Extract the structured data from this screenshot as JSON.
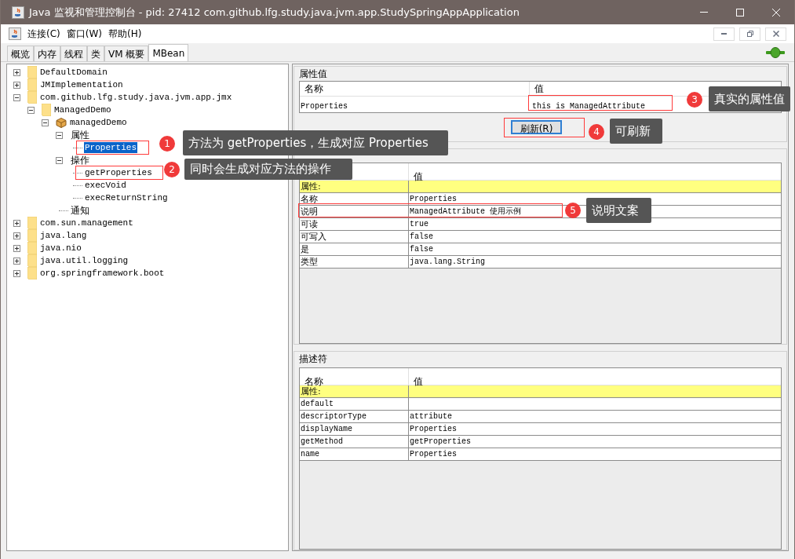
{
  "window": {
    "title": "Java 监视和管理控制台 - pid: 27412 com.github.lfg.study.java.jvm.app.StudySpringAppApplication"
  },
  "menu": [
    "连接(C)",
    "窗口(W)",
    "帮助(H)"
  ],
  "tabs": [
    {
      "label": "概览",
      "selected": false
    },
    {
      "label": "内存",
      "selected": false
    },
    {
      "label": "线程",
      "selected": false
    },
    {
      "label": "类",
      "selected": false
    },
    {
      "label": "VM 概要",
      "selected": false
    },
    {
      "label": "MBean",
      "selected": true
    }
  ],
  "tree": [
    {
      "label": "DefaultDomain",
      "kind": "domain",
      "expanded": false,
      "selected": false
    },
    {
      "label": "JMImplementation",
      "kind": "domain",
      "expanded": false,
      "selected": false
    },
    {
      "label": "com.github.lfg.study.java.jvm.app.jmx",
      "kind": "domain",
      "expanded": true,
      "selected": false,
      "children": [
        {
          "label": "ManagedDemo",
          "kind": "domain",
          "expanded": true,
          "selected": false,
          "children": [
            {
              "label": "managedDemo",
              "kind": "mbean",
              "expanded": true,
              "selected": false,
              "children": [
                {
                  "label": "属性",
                  "kind": "group",
                  "expanded": true,
                  "selected": false,
                  "children": [
                    {
                      "label": "Properties",
                      "kind": "member",
                      "selected": true
                    }
                  ]
                },
                {
                  "label": "操作",
                  "kind": "group",
                  "expanded": true,
                  "selected": false,
                  "children": [
                    {
                      "label": "getProperties",
                      "kind": "member",
                      "selected": false
                    },
                    {
                      "label": "execVoid",
                      "kind": "member",
                      "selected": false
                    },
                    {
                      "label": "execReturnString",
                      "kind": "member",
                      "selected": false
                    }
                  ]
                },
                {
                  "label": "通知",
                  "kind": "group",
                  "selected": false
                }
              ]
            }
          ]
        }
      ]
    },
    {
      "label": "com.sun.management",
      "kind": "domain",
      "expanded": false,
      "selected": false
    },
    {
      "label": "java.lang",
      "kind": "domain",
      "expanded": false,
      "selected": false
    },
    {
      "label": "java.nio",
      "kind": "domain",
      "expanded": false,
      "selected": false
    },
    {
      "label": "java.util.logging",
      "kind": "domain",
      "expanded": false,
      "selected": false
    },
    {
      "label": "org.springframework.boot",
      "kind": "domain",
      "expanded": false,
      "selected": false
    }
  ],
  "attribute_value": {
    "title": "属性值",
    "name_column": "名称",
    "value_column": "值",
    "rows": [
      {
        "name": "Properties",
        "value": "this is ManagedAttribute"
      }
    ],
    "refresh_button": "刷新(R)"
  },
  "attribute_info": {
    "value_column": "值",
    "rows": [
      {
        "kind": "section",
        "name": "属性:"
      },
      {
        "kind": "field",
        "name": "名称",
        "value": "Properties"
      },
      {
        "kind": "field",
        "name": "说明",
        "value": "ManagedAttribute 使用示例"
      },
      {
        "kind": "field",
        "name": "可读",
        "value": "true"
      },
      {
        "kind": "field",
        "name": "可写入",
        "value": "false"
      },
      {
        "kind": "field",
        "name": "是",
        "value": "false"
      },
      {
        "kind": "field",
        "name": "类型",
        "value": "java.lang.String"
      }
    ]
  },
  "descriptor": {
    "title": "描述符",
    "name_column": "名称",
    "value_column": "值",
    "rows": [
      {
        "kind": "section",
        "name": "属性:"
      },
      {
        "kind": "field",
        "name": "default"
      },
      {
        "kind": "field",
        "name": "descriptorType",
        "value": "attribute"
      },
      {
        "kind": "field",
        "name": "displayName",
        "value": "Properties"
      },
      {
        "kind": "field",
        "name": "getMethod",
        "value": "getProperties"
      },
      {
        "kind": "field",
        "name": "name",
        "value": "Properties"
      }
    ]
  },
  "callouts": [
    {
      "number": "1",
      "text": "方法为 getProperties，生成对应 Properties"
    },
    {
      "number": "2",
      "text": "同时会生成对应方法的操作"
    },
    {
      "number": "3",
      "text": "真实的属性值"
    },
    {
      "number": "4",
      "text": "可刷新"
    },
    {
      "number": "5",
      "text": "说明文案"
    }
  ]
}
